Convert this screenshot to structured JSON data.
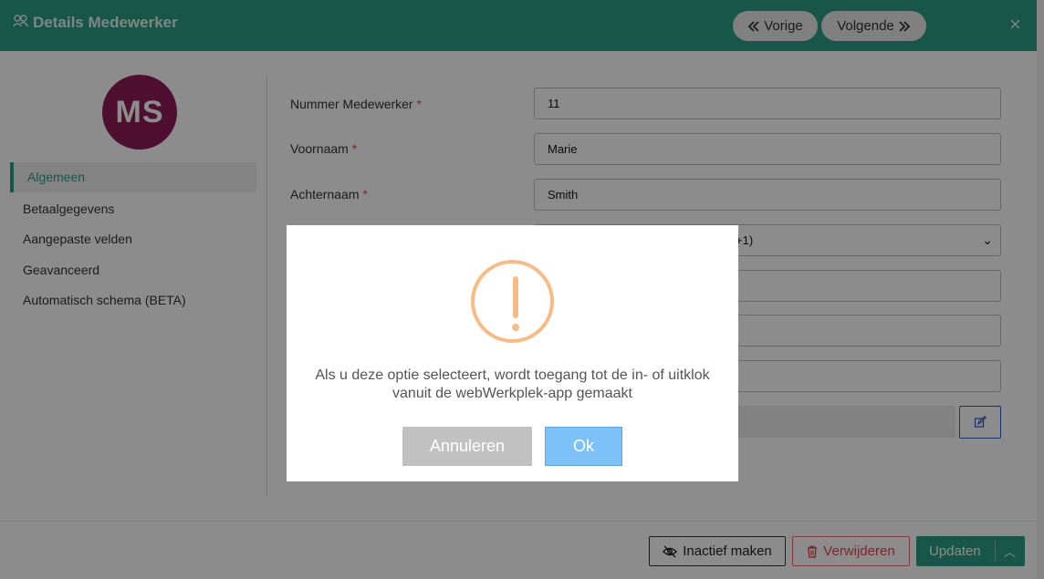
{
  "header": {
    "title": "Details Medewerker",
    "prev_label": "Vorige",
    "next_label": "Volgende",
    "close_glyph": "×",
    "accent": "#2b9d85"
  },
  "sidebar": {
    "avatar_initials": "MS",
    "avatar_color": "#8e1d58",
    "items": [
      {
        "label": "Algemeen"
      },
      {
        "label": "Betaalgegevens"
      },
      {
        "label": "Aangepaste velden"
      },
      {
        "label": "Geavanceerd"
      },
      {
        "label": "Automatisch schema (BETA)"
      }
    ],
    "active_index": 0
  },
  "form": {
    "fields": [
      {
        "label": "Nummer Medewerker",
        "required": "*",
        "value": "11"
      },
      {
        "label": "Voornaam",
        "required": "*",
        "value": "Marie"
      },
      {
        "label": "Achternaam",
        "required": "*",
        "value": "Smith"
      },
      {
        "label": "",
        "value": "+1)"
      }
    ]
  },
  "footer": {
    "inactive_label": "Inactief maken",
    "delete_label": "Verwijderen",
    "update_label": "Updaten"
  },
  "dialog": {
    "icon": "warning-icon",
    "line1": "Als u deze optie selecteert, wordt toegang tot de in- of uitklok",
    "line2": "vanuit de webWerkplek-app gemaakt",
    "cancel_label": "Annuleren",
    "ok_label": "Ok"
  }
}
